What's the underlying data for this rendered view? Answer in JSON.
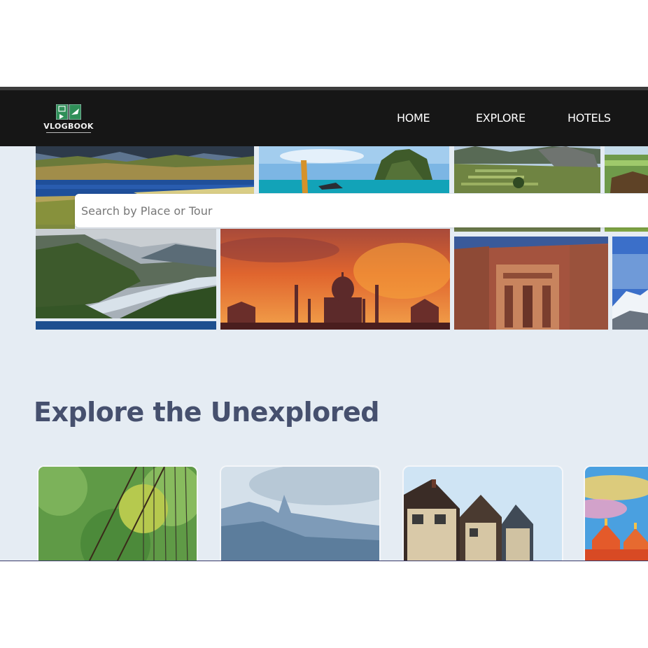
{
  "brand": {
    "name": "VLOGBOOK",
    "logo_icon": "vlogbook-logo-icon"
  },
  "nav": {
    "items": [
      {
        "label": "HOME"
      },
      {
        "label": "EXPLORE"
      },
      {
        "label": "HOTELS"
      }
    ]
  },
  "search": {
    "placeholder": "Search by Place or Tour",
    "value": ""
  },
  "gallery": {
    "tiles": [
      {
        "subject": "lake-mountains"
      },
      {
        "subject": "tropical-island-boat"
      },
      {
        "subject": "terraced-ruins"
      },
      {
        "subject": "green-valley"
      },
      {
        "subject": "river-valley"
      },
      {
        "subject": "taj-mahal-sunset"
      },
      {
        "subject": "rock-carved-temple"
      },
      {
        "subject": "snowy-peaks"
      }
    ]
  },
  "explore": {
    "title": "Explore the Unexplored",
    "cards": [
      {
        "subject": "rope-bridge-forest"
      },
      {
        "subject": "misty-mountains"
      },
      {
        "subject": "tudor-houses"
      },
      {
        "subject": "palace-domes"
      }
    ]
  },
  "colors": {
    "navbar": "#161616",
    "page_background": "#e5ecf3",
    "heading": "#46506e"
  }
}
